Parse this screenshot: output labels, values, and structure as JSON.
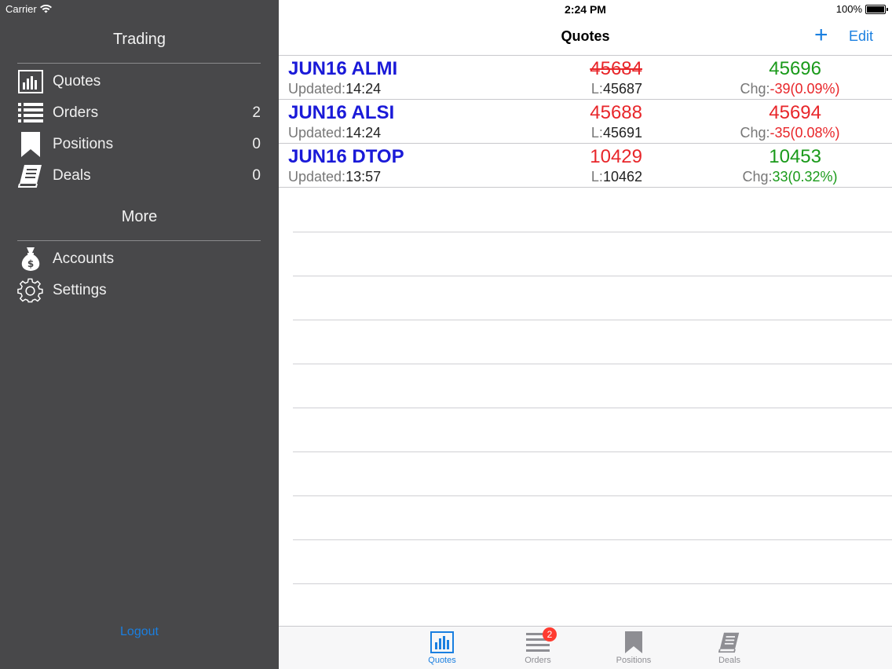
{
  "status_bar": {
    "carrier": "Carrier",
    "time": "2:24 PM",
    "battery": "100%"
  },
  "sidebar": {
    "trading_title": "Trading",
    "trading_items": [
      {
        "label": "Quotes",
        "icon": "bar-chart-icon",
        "count": ""
      },
      {
        "label": "Orders",
        "icon": "list-icon",
        "count": "2"
      },
      {
        "label": "Positions",
        "icon": "bookmark-icon",
        "count": "0"
      },
      {
        "label": "Deals",
        "icon": "book-icon",
        "count": "0"
      }
    ],
    "more_title": "More",
    "more_items": [
      {
        "label": "Accounts",
        "icon": "money-bag-icon"
      },
      {
        "label": "Settings",
        "icon": "gear-icon"
      }
    ],
    "logout_label": "Logout"
  },
  "nav": {
    "title": "Quotes",
    "add_label": "+",
    "edit_label": "Edit"
  },
  "quotes": [
    {
      "name": "JUN16 ALMI",
      "updated_label": "Updated:",
      "updated": "14:24",
      "bid": "45684",
      "low_label": "L:",
      "low": "45687",
      "ask": "45696",
      "chg_label": "Chg:",
      "chg": "-39",
      "chg_pct": "(0.09%)",
      "direction": "down"
    },
    {
      "name": "JUN16 ALSI",
      "updated_label": "Updated:",
      "updated": "14:24",
      "bid": "45688",
      "low_label": "L:",
      "low": "45691",
      "ask": "45694",
      "chg_label": "Chg:",
      "chg": "-35",
      "chg_pct": "(0.08%)",
      "direction": "down"
    },
    {
      "name": "JUN16 DTOP",
      "updated_label": "Updated:",
      "updated": "13:57",
      "bid": "10429",
      "low_label": "L:",
      "low": "10462",
      "ask": "10453",
      "chg_label": "Chg:",
      "chg": "33",
      "chg_pct": "(0.32%)",
      "direction": "up"
    }
  ],
  "tabbar": {
    "tabs": [
      {
        "label": "Quotes",
        "icon": "bar-chart-icon",
        "active": true
      },
      {
        "label": "Orders",
        "icon": "list-icon",
        "badge": "2"
      },
      {
        "label": "Positions",
        "icon": "bookmark-icon"
      },
      {
        "label": "Deals",
        "icon": "book-icon"
      }
    ]
  },
  "colors": {
    "accent": "#1a7fe0",
    "down": "#e8262a",
    "up": "#1a9a1a",
    "symbol": "#1a1ad8",
    "sidebar_bg": "#48484a"
  }
}
